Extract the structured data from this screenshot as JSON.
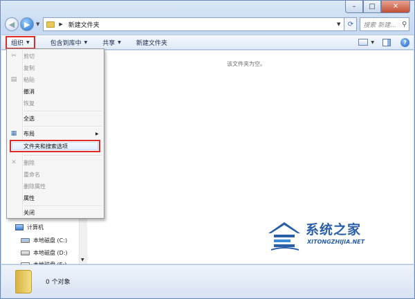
{
  "address": {
    "path": "新建文件夹",
    "search_placeholder": "搜索 新建..."
  },
  "toolbar": {
    "organize": "组织",
    "include_in_library": "包含到库中",
    "share": "共享",
    "new_folder": "新建文件夹"
  },
  "menu": {
    "cut": "剪切",
    "copy": "复制",
    "paste": "粘贴",
    "undo": "撤消",
    "redo": "恢复",
    "select_all": "全选",
    "layout": "布局",
    "folder_options": "文件夹和搜索选项",
    "delete": "删除",
    "rename": "重命名",
    "remove_properties": "删除属性",
    "properties": "属性",
    "close": "关闭"
  },
  "nav": {
    "computer": "计算机",
    "drive_c": "本地磁盘 (C:)",
    "drive_d": "本地磁盘 (D:)",
    "drive_e": "本地磁盘 (E:)"
  },
  "content": {
    "empty_message": "该文件夹为空。"
  },
  "status": {
    "count": "0 个对象"
  },
  "watermark": {
    "title": "系统之家",
    "url": "XITONGZHIJIA.NET"
  },
  "colors": {
    "highlight_box": "#e02a2a",
    "watermark": "#2a5fa8"
  }
}
